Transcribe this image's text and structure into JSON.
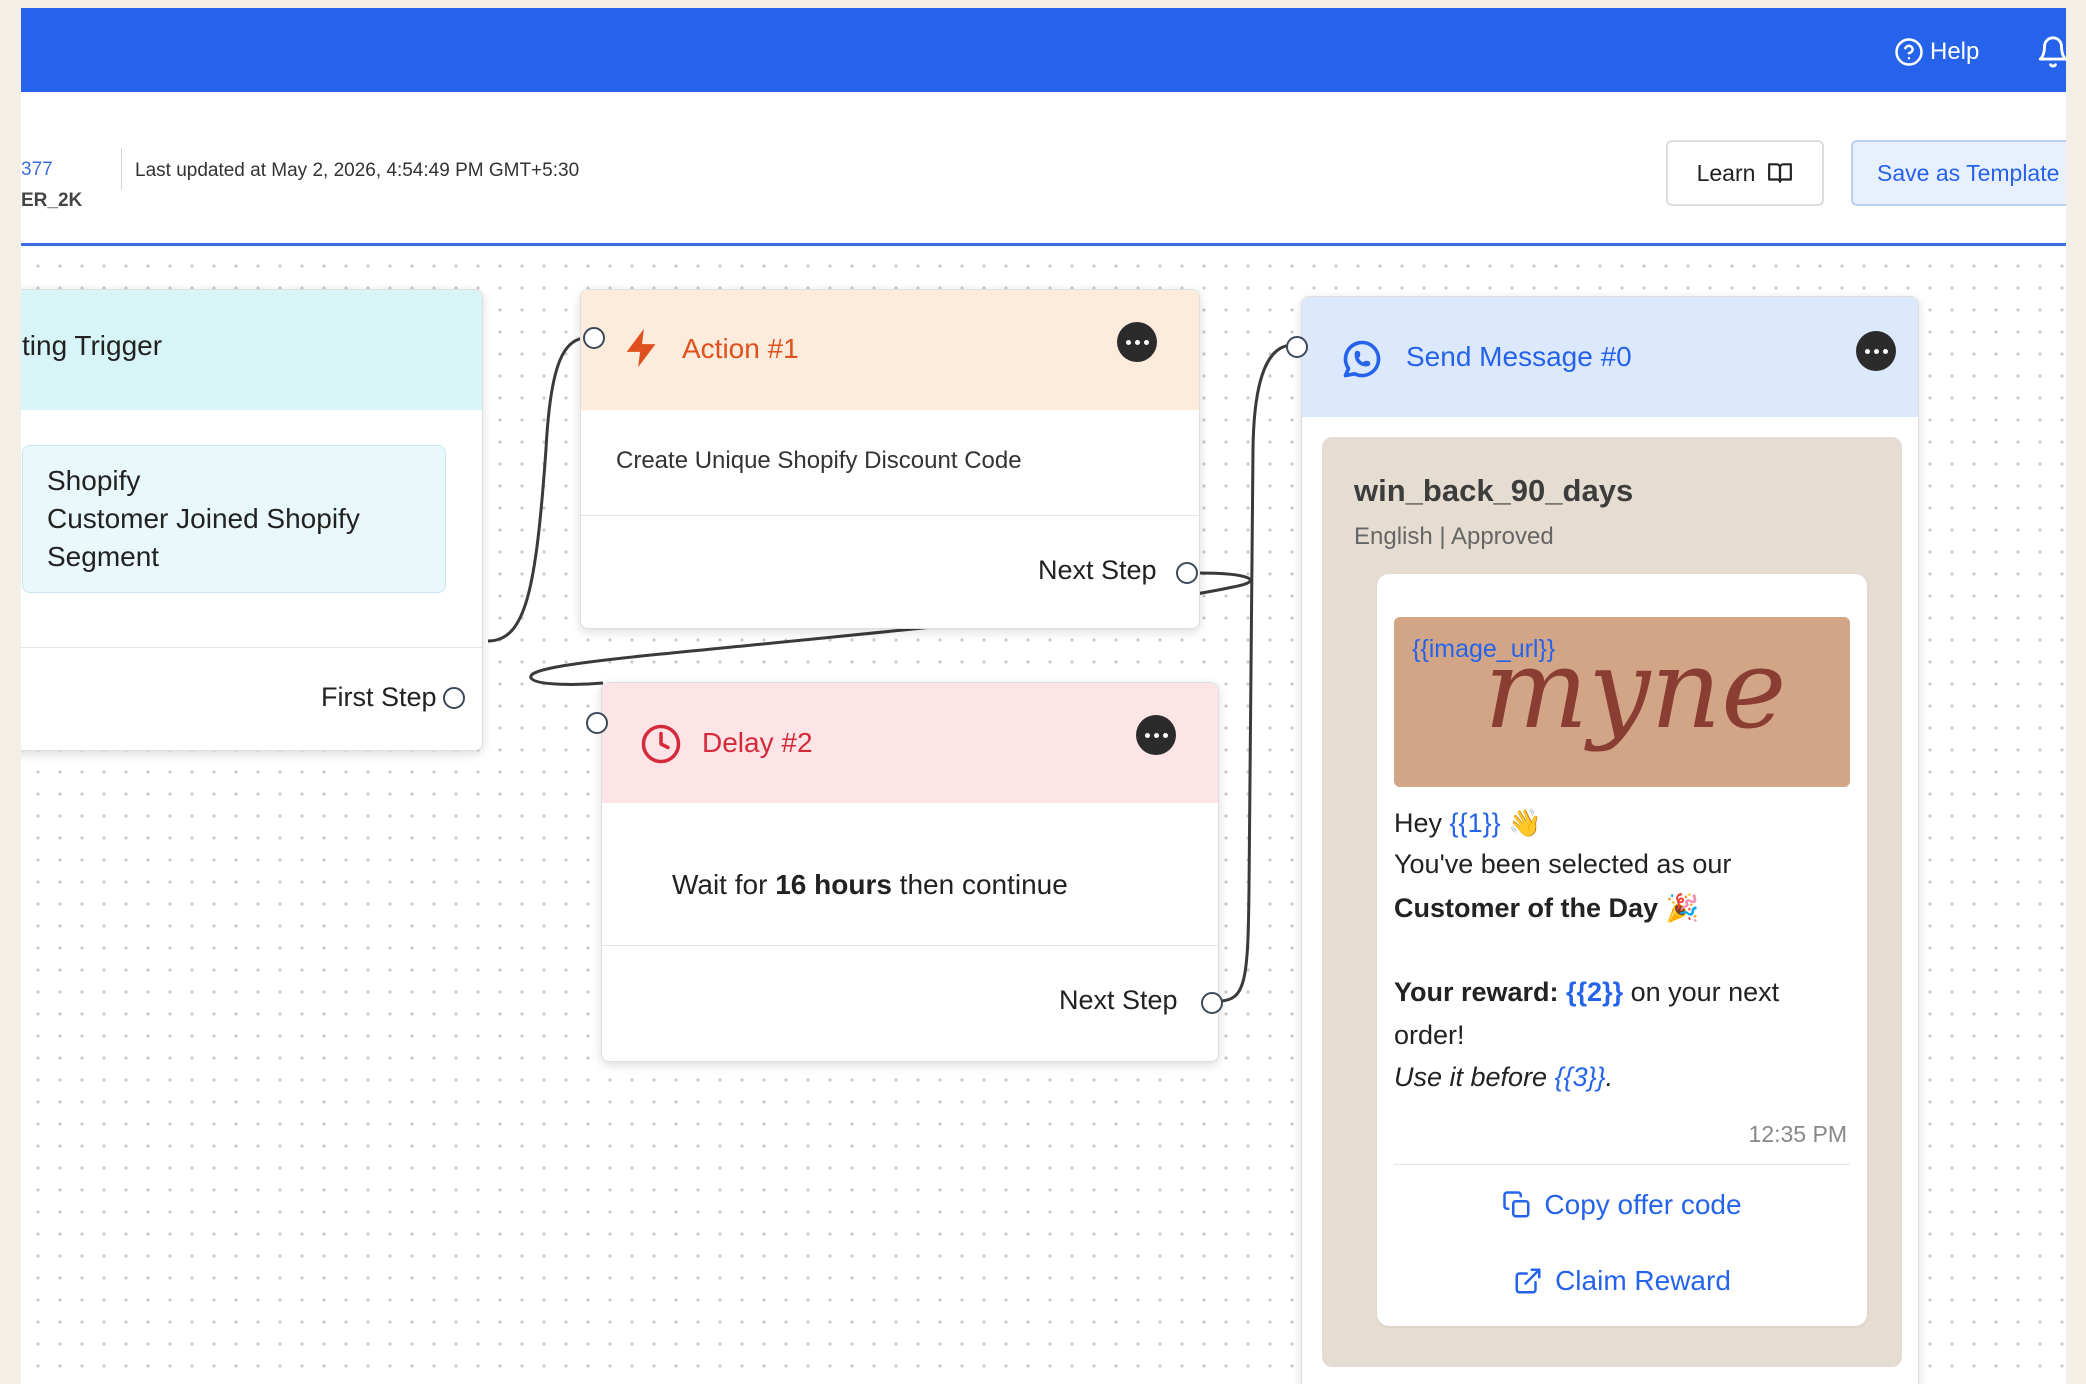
{
  "topbar": {
    "help_label": "Help"
  },
  "header": {
    "flow_id_top": "377",
    "flow_id_bottom": "ER_2K",
    "last_updated": "Last updated at May 2, 2026, 4:54:49 PM GMT+5:30",
    "learn_label": "Learn",
    "save_template_label": "Save as Template"
  },
  "trigger_node": {
    "title": "ting Trigger",
    "source": "Shopify",
    "event_line1": "Customer Joined Shopify",
    "event_line2": "Segment",
    "step_label": "First Step"
  },
  "action_node": {
    "title": "Action #1",
    "description": "Create Unique Shopify Discount Code",
    "step_label": "Next Step"
  },
  "delay_node": {
    "title": "Delay #2",
    "desc_prefix": "Wait for ",
    "desc_value": "16 hours",
    "desc_suffix": " then continue",
    "step_label": "Next Step"
  },
  "message_node": {
    "title": "Send Message #0",
    "template_name": "win_back_90_days",
    "template_meta": "English | Approved",
    "image_var": "{{image_url}}",
    "brand_logo_text": "myne",
    "greeting": "Hey ",
    "var1": "{{1}}",
    "greeting_emoji": "👋",
    "line2": "You've been selected as our",
    "line3": "Customer of the Day",
    "line3_emoji": "🎉",
    "reward_label": "Your reward:",
    "var2": "{{2}}",
    "reward_suffix": " on your next",
    "line5": "order!",
    "use_before": "Use it before ",
    "var3": "{{3}}",
    "period": ".",
    "time": "12:35 PM",
    "cta1": "Copy offer code",
    "cta2": "Claim Reward"
  },
  "icons": {
    "help": "help-circle-icon",
    "bell": "bell-icon",
    "learn": "book-open-icon",
    "action": "lightning-bolt-icon",
    "delay": "clock-icon",
    "message": "whatsapp-icon",
    "more": "more-horizontal-icon",
    "cta1": "copy-icon",
    "cta2": "external-link-icon"
  },
  "colors": {
    "topbar": "#2563eb",
    "trigger_header": "#d7f4f6",
    "action_header": "#fdebdc",
    "action_accent": "#e0501e",
    "delay_header": "#fde4e6",
    "delay_accent": "#d42a3a",
    "message_header": "#dce8fc",
    "message_accent": "#2563eb",
    "wa_background": "#e6ddd2",
    "brand_logo": "#8a3d33"
  }
}
